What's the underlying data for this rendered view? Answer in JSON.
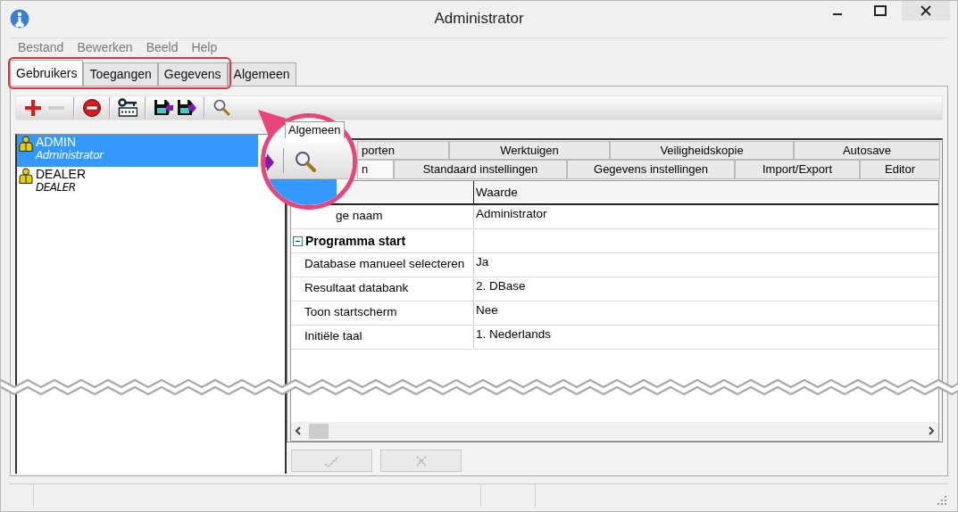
{
  "window": {
    "title": "Administrator"
  },
  "menu": [
    {
      "label": "Bestand",
      "disabled": true
    },
    {
      "label": "Bewerken",
      "disabled": true
    },
    {
      "label": "Beeld",
      "disabled": true
    },
    {
      "label": "Help",
      "disabled": true
    }
  ],
  "tabs": [
    {
      "label": "Gebruikers",
      "selected": true
    },
    {
      "label": "Toegangen",
      "selected": false
    },
    {
      "label": "Gegevens",
      "selected": false
    },
    {
      "label": "Algemeen",
      "selected": false
    }
  ],
  "toolbar": [
    {
      "kind": "add",
      "disabled": false
    },
    {
      "kind": "remove",
      "disabled": true
    },
    {
      "kind": "separator"
    },
    {
      "kind": "block",
      "disabled": false
    },
    {
      "kind": "separator"
    },
    {
      "kind": "password",
      "disabled": false
    },
    {
      "kind": "separator"
    },
    {
      "kind": "import",
      "disabled": false
    },
    {
      "kind": "export",
      "disabled": false
    },
    {
      "kind": "separator"
    },
    {
      "kind": "search",
      "disabled": false
    }
  ],
  "users": [
    {
      "name": "ADMIN",
      "role": "Administrator",
      "selected": true
    },
    {
      "name": "DEALER",
      "role": "DEALER",
      "selected": false
    }
  ],
  "settings": {
    "panel_tab": {
      "label": "Algemeen"
    },
    "tab_rows": [
      [
        {
          "kind": "cut",
          "label": "porten",
          "selected": false
        },
        {
          "kind": "tab",
          "label": "Werktuigen",
          "selected": false
        },
        {
          "kind": "tab",
          "label": "Veiligheidskopie",
          "selected": false
        },
        {
          "kind": "tab",
          "label": "Autosave",
          "selected": false
        }
      ],
      [
        {
          "kind": "cut",
          "label": "n",
          "selected": true
        },
        {
          "kind": "tab",
          "label": "Standaard instellingen",
          "selected": false
        },
        {
          "kind": "tab",
          "label": "Gegevens instellingen",
          "selected": false
        },
        {
          "kind": "tab",
          "label": "Import/Export",
          "selected": false
        },
        {
          "kind": "tab",
          "label": "Editor",
          "selected": false
        }
      ]
    ],
    "value_column": "Waarde",
    "rows": [
      {
        "kind": "cut",
        "name": "ge naam",
        "value": "Administrator"
      },
      {
        "kind": "group",
        "name": "Programma start",
        "expanded": true
      },
      {
        "kind": "property",
        "name": "Database manueel selecteren",
        "value": "Ja"
      },
      {
        "kind": "property",
        "name": "Resultaat databank",
        "value": "2. DBase"
      },
      {
        "kind": "property",
        "name": "Toon startscherm",
        "value": "Nee"
      },
      {
        "kind": "property",
        "name": "Initiële taal",
        "value": "1. Nederlands"
      }
    ],
    "buttons": [
      {
        "kind": "accept",
        "disabled": true
      },
      {
        "kind": "cancel",
        "disabled": true
      }
    ]
  }
}
